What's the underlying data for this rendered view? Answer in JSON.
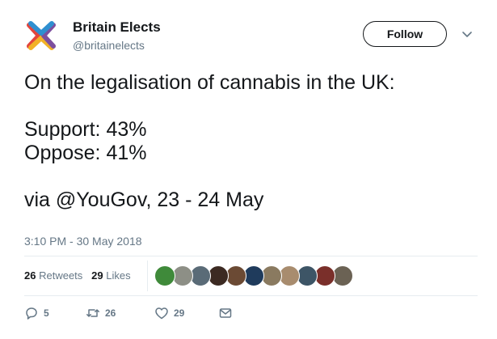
{
  "account": {
    "name": "Britain Elects",
    "handle": "@britainelects"
  },
  "follow_label": "Follow",
  "tweet": {
    "line1": "On the legalisation of cannabis in the UK:",
    "line2": "Support: 43%",
    "line3": "Oppose: 41%",
    "line4": "via @YouGov, 23 - 24 May"
  },
  "timestamp": "3:10 PM - 30 May 2018",
  "stats": {
    "retweets_count": "26",
    "retweets_label": "Retweets",
    "likes_count": "29",
    "likes_label": "Likes"
  },
  "avatar_colors": [
    "#3f8a3a",
    "#8d8f86",
    "#5a6b77",
    "#3c2a22",
    "#6b4a34",
    "#1f3b5c",
    "#8a7a60",
    "#a88c6e",
    "#3d5566",
    "#7a2f2a",
    "#6b6254"
  ],
  "actions": {
    "reply_count": "5",
    "retweet_count": "26",
    "like_count": "29"
  },
  "icons": [
    "britain-elects-logo",
    "chevron-down-icon",
    "reply-icon",
    "retweet-icon",
    "heart-icon",
    "envelope-icon"
  ],
  "colors": {
    "logo_red": "#e2453c",
    "logo_blue": "#2f8fd0",
    "logo_yellow": "#f2b227",
    "logo_purple": "#7d4f9e",
    "text": "#14171a",
    "secondary": "#657786"
  }
}
